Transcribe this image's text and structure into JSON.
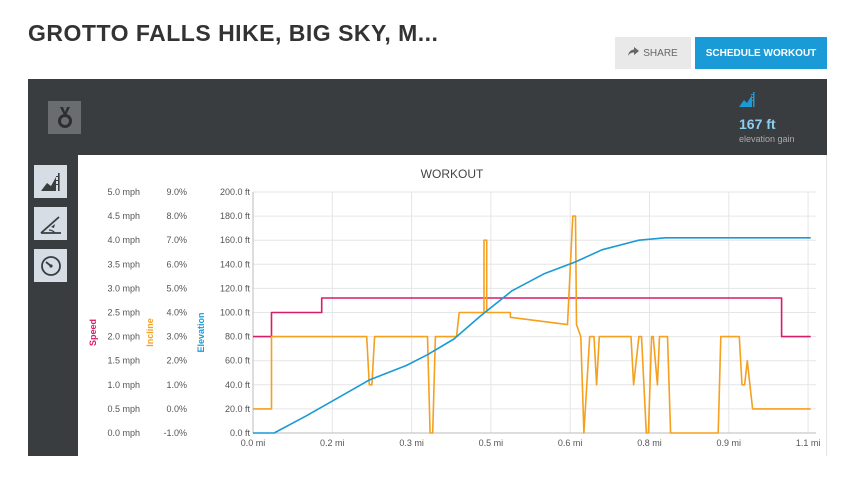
{
  "header": {
    "title": "GROTTO FALLS HIKE, BIG SKY, M...",
    "share_label": "SHARE",
    "schedule_label": "SCHEDULE WORKOUT"
  },
  "stats": {
    "elevation_value": "167 ft",
    "elevation_label": "elevation gain"
  },
  "side_icons": [
    "elevation-icon",
    "incline-icon",
    "speedometer-icon"
  ],
  "colors": {
    "speed": "#d81b6a",
    "incline": "#f5a01e",
    "elevation": "#1a9ad6",
    "accent": "#1a9ad6",
    "dark": "#3a3d40"
  },
  "chart_data": {
    "type": "line",
    "title": "WORKOUT",
    "xlabel": "",
    "x_ticks": [
      "0.0 mi",
      "0.2 mi",
      "0.3 mi",
      "0.5 mi",
      "0.6 mi",
      "0.8 mi",
      "0.9 mi",
      "1.1 mi"
    ],
    "x_tick_values": [
      0.0,
      0.15,
      0.3,
      0.45,
      0.6,
      0.75,
      0.9,
      1.05
    ],
    "xlim": [
      0,
      1.065
    ],
    "axes": [
      {
        "name": "Speed",
        "color": "#d81b6a",
        "ticks": [
          "0.0 mph",
          "0.5 mph",
          "1.0 mph",
          "1.5 mph",
          "2.0 mph",
          "2.5 mph",
          "3.0 mph",
          "3.5 mph",
          "4.0 mph",
          "4.5 mph",
          "5.0 mph"
        ],
        "ylim": [
          0,
          5
        ]
      },
      {
        "name": "Incline",
        "color": "#f5a01e",
        "ticks": [
          "-1.0%",
          "0.0%",
          "1.0%",
          "2.0%",
          "3.0%",
          "4.0%",
          "5.0%",
          "6.0%",
          "7.0%",
          "8.0%",
          "9.0%"
        ],
        "ylim": [
          -1,
          9
        ]
      },
      {
        "name": "Elevation",
        "color": "#1a9ad6",
        "ticks": [
          "0.0 ft",
          "20.0 ft",
          "40.0 ft",
          "60.0 ft",
          "80.0 ft",
          "100.0 ft",
          "120.0 ft",
          "140.0 ft",
          "160.0 ft",
          "180.0 ft",
          "200.0 ft"
        ],
        "ylim": [
          0,
          200
        ]
      }
    ],
    "series": [
      {
        "name": "Speed",
        "axis": 0,
        "x": [
          0,
          0.035,
          0.035,
          0.13,
          0.13,
          1.0,
          1.0,
          1.055
        ],
        "y": [
          2.0,
          2.0,
          2.5,
          2.5,
          2.8,
          2.8,
          2.0,
          2.0
        ]
      },
      {
        "name": "Incline",
        "axis": 1,
        "x": [
          0,
          0.035,
          0.035,
          0.215,
          0.22,
          0.225,
          0.23,
          0.33,
          0.335,
          0.34,
          0.345,
          0.385,
          0.39,
          0.437,
          0.437,
          0.442,
          0.442,
          0.487,
          0.487,
          0.595,
          0.605,
          0.61,
          0.612,
          0.62,
          0.626,
          0.637,
          0.645,
          0.65,
          0.655,
          0.715,
          0.72,
          0.73,
          0.735,
          0.744,
          0.748,
          0.754,
          0.757,
          0.765,
          0.769,
          0.784,
          0.79,
          0.88,
          0.885,
          0.92,
          0.925,
          0.93,
          0.935,
          0.94,
          0.945,
          0.95,
          0.953,
          0.958,
          0.963,
          1.055
        ],
        "y": [
          0.0,
          0.0,
          3.0,
          3.0,
          1.0,
          1.0,
          3.0,
          3.0,
          -1.0,
          -1.0,
          3.0,
          3.0,
          4.0,
          4.0,
          7.0,
          7.0,
          4.0,
          4.0,
          3.8,
          3.5,
          8.0,
          8.0,
          3.5,
          3.0,
          -1.0,
          3.0,
          3.0,
          1.0,
          3.0,
          3.0,
          1.0,
          3.0,
          3.0,
          -1.0,
          -1.0,
          3.0,
          3.0,
          1.0,
          3.0,
          3.0,
          -1.0,
          -1.0,
          3.0,
          3.0,
          1.0,
          1.0,
          2.0,
          1.0,
          0.0,
          0.0,
          0.0,
          0.0,
          0.0,
          0.0
        ]
      },
      {
        "name": "Elevation",
        "axis": 2,
        "x": [
          0,
          0.04,
          0.1,
          0.16,
          0.22,
          0.29,
          0.33,
          0.38,
          0.43,
          0.49,
          0.55,
          0.61,
          0.66,
          0.73,
          0.78,
          0.84,
          0.88,
          0.93,
          1.055
        ],
        "y": [
          0,
          0,
          14,
          29,
          44,
          56,
          65,
          78,
          97,
          118,
          132,
          142,
          152,
          160,
          162,
          162,
          162,
          162,
          162
        ]
      }
    ]
  }
}
